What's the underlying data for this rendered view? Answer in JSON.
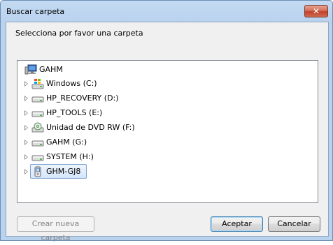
{
  "window": {
    "title": "Buscar carpeta",
    "close_glyph": "✕"
  },
  "prompt": "Selecciona por favor una carpeta",
  "tree": {
    "root": {
      "label": "GAHM",
      "icon": "computer-icon"
    },
    "items": [
      {
        "label": "Windows (C:)",
        "icon": "windows-drive-icon"
      },
      {
        "label": "HP_RECOVERY (D:)",
        "icon": "hard-drive-icon"
      },
      {
        "label": "HP_TOOLS (E:)",
        "icon": "hard-drive-icon"
      },
      {
        "label": "Unidad de DVD RW (F:)",
        "icon": "dvd-drive-icon"
      },
      {
        "label": "GAHM (G:)",
        "icon": "hard-drive-icon"
      },
      {
        "label": "SYSTEM (H:)",
        "icon": "hard-drive-icon"
      },
      {
        "label": "GHM-GJ8",
        "icon": "portable-device-icon",
        "selected": true
      }
    ]
  },
  "buttons": {
    "new_folder": "Crear nueva carpeta",
    "ok": "Aceptar",
    "cancel": "Cancelar"
  },
  "colors": {
    "title_bar": "#b9d2ee",
    "close_button": "#c0412a",
    "selection_border": "#7da2ce",
    "selection_fill": "#d4e6fb"
  }
}
